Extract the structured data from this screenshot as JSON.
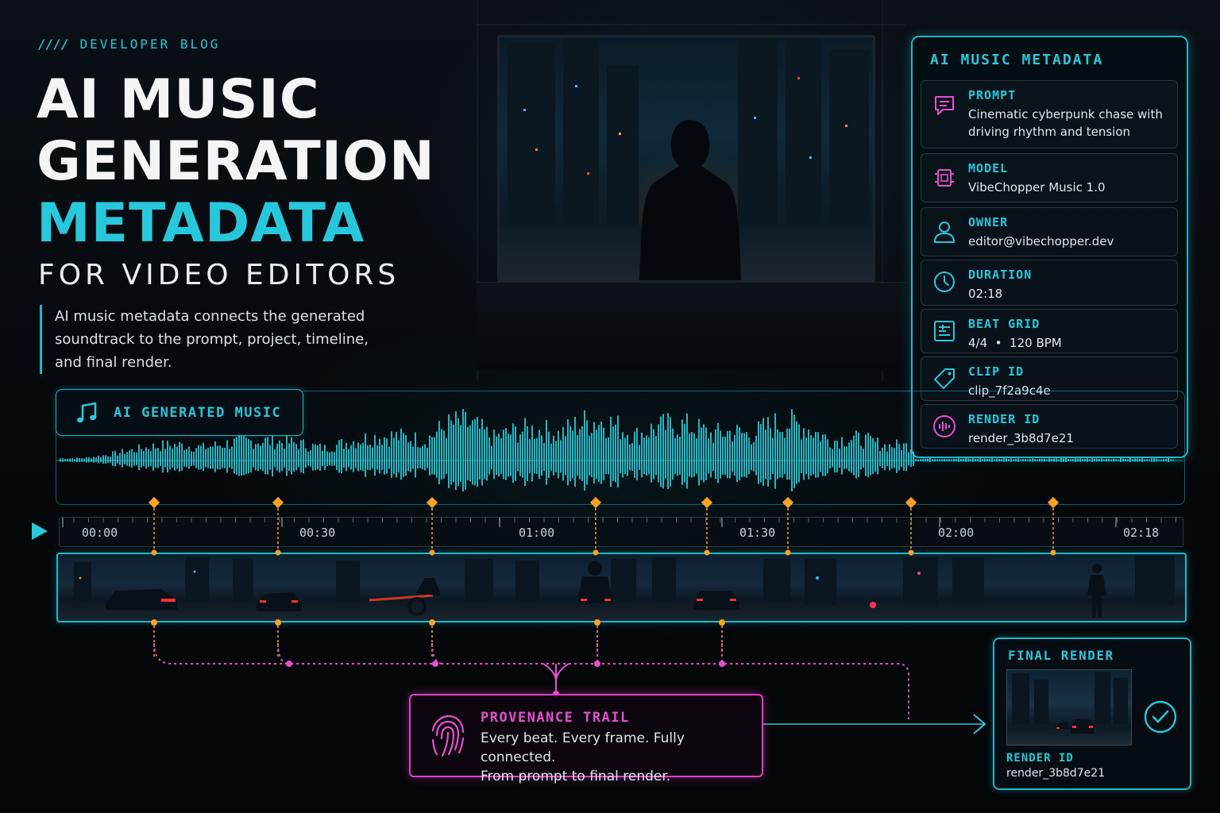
{
  "header": {
    "eyebrow_mark": "////",
    "eyebrow": "DEVELOPER BLOG",
    "title_line1": "AI MUSIC",
    "title_line2": "GENERATION",
    "title_line3": "METADATA",
    "subtitle": "FOR VIDEO EDITORS",
    "intro": "AI music metadata connects the generated soundtrack to the prompt, project, timeline, and final render."
  },
  "metadata_panel": {
    "title": "AI MUSIC METADATA",
    "rows": [
      {
        "label": "PROMPT",
        "value": "Cinematic cyberpunk chase with driving rhythm and tension",
        "icon": "chat-bubble-icon",
        "color": "#e84fd0"
      },
      {
        "label": "MODEL",
        "value": "VibeChopper Music 1.0",
        "icon": "chip-icon",
        "color": "#e84fd0"
      },
      {
        "label": "OWNER",
        "value": "editor@vibechopper.dev",
        "icon": "user-icon",
        "color": "#28c8dc"
      },
      {
        "label": "DURATION",
        "value": "02:18",
        "icon": "clock-icon",
        "color": "#28c8dc"
      },
      {
        "label": "BEAT GRID",
        "value": "4/4  •  120 BPM",
        "icon": "grid-icon",
        "color": "#28c8dc"
      },
      {
        "label": "CLIP ID",
        "value": "clip_7f2a9c4e",
        "icon": "tag-icon",
        "color": "#28c8dc"
      },
      {
        "label": "RENDER ID",
        "value": "render_3b8d7e21",
        "icon": "waveform-icon",
        "color": "#e84fd0"
      }
    ]
  },
  "music": {
    "label": "AI GENERATED MUSIC",
    "icon": "music-note-icon"
  },
  "timeline": {
    "labels": [
      "00:00",
      "00:30",
      "01:00",
      "01:30",
      "02:00",
      "02:18"
    ]
  },
  "provenance": {
    "title": "PROVENANCE TRAIL",
    "line1": "Every beat. Every frame. Fully connected.",
    "line2": "From prompt to final render.",
    "icon": "fingerprint-icon"
  },
  "final_render": {
    "title": "FINAL RENDER",
    "render_label": "RENDER ID",
    "render_value": "render_3b8d7e21",
    "icon": "check-circle-icon"
  },
  "colors": {
    "accent_cyan": "#28c8dc",
    "accent_magenta": "#e84fd0",
    "marker_orange": "#ffa020"
  }
}
